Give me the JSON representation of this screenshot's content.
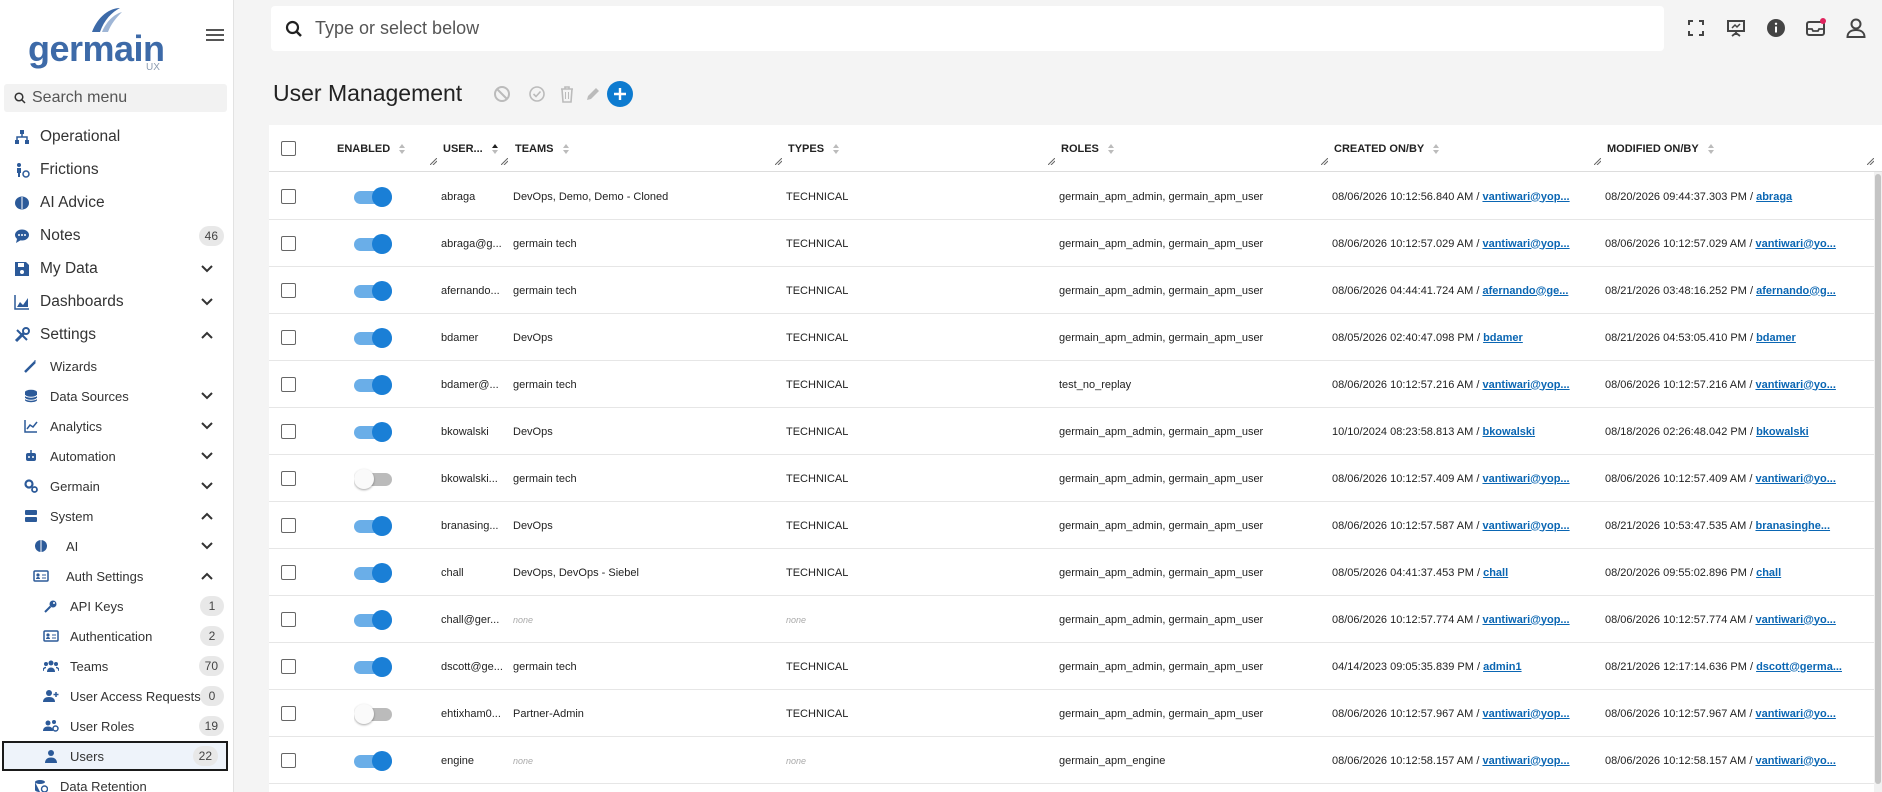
{
  "sidebar": {
    "logo_text": "germain",
    "logo_sub": "UX",
    "search_placeholder": "Search menu",
    "items": [
      {
        "label": "Operational"
      },
      {
        "label": "Frictions"
      },
      {
        "label": "AI Advice"
      },
      {
        "label": "Notes",
        "count": "46"
      },
      {
        "label": "My Data"
      },
      {
        "label": "Dashboards"
      },
      {
        "label": "Settings"
      },
      {
        "label": "Wizards"
      },
      {
        "label": "Data Sources"
      },
      {
        "label": "Analytics"
      },
      {
        "label": "Automation"
      },
      {
        "label": "Germain"
      },
      {
        "label": "System"
      },
      {
        "label": "AI"
      },
      {
        "label": "Auth Settings"
      },
      {
        "label": "API Keys",
        "count": "1"
      },
      {
        "label": "Authentication",
        "count": "2"
      },
      {
        "label": "Teams",
        "count": "70"
      },
      {
        "label": "User Access Requests",
        "count": "0"
      },
      {
        "label": "User Roles",
        "count": "19"
      },
      {
        "label": "Users",
        "count": "22"
      },
      {
        "label": "Data Retention"
      }
    ]
  },
  "topbar": {
    "search_placeholder": "Type or select below"
  },
  "page": {
    "title": "User Management"
  },
  "table": {
    "headers": {
      "enabled": "ENABLED",
      "user": "USER...",
      "teams": "TEAMS",
      "types": "TYPES",
      "roles": "ROLES",
      "created": "CREATED ON/BY",
      "modified": "MODIFIED ON/BY"
    },
    "rows": [
      {
        "enabled": true,
        "user": "abraga",
        "teams": "DevOps, Demo, Demo - Cloned",
        "types": "TECHNICAL",
        "roles": "germain_apm_admin, germain_apm_user",
        "created_on": "08/06/2026 10:12:56.840 AM /",
        "created_by": "vantiwari@yop...",
        "modified_on": "08/20/2026 09:44:37.303 PM /",
        "modified_by": "abraga"
      },
      {
        "enabled": true,
        "user": "abraga@g...",
        "teams": "germain tech",
        "types": "TECHNICAL",
        "roles": "germain_apm_admin, germain_apm_user",
        "created_on": "08/06/2026 10:12:57.029 AM /",
        "created_by": "vantiwari@yop...",
        "modified_on": "08/06/2026 10:12:57.029 AM /",
        "modified_by": "vantiwari@yo..."
      },
      {
        "enabled": true,
        "user": "afernando...",
        "teams": "germain tech",
        "types": "TECHNICAL",
        "roles": "germain_apm_admin, germain_apm_user",
        "created_on": "08/06/2026 04:44:41.724 AM /",
        "created_by": "afernando@ge...",
        "modified_on": "08/21/2026 03:48:16.252 PM /",
        "modified_by": "afernando@g..."
      },
      {
        "enabled": true,
        "user": "bdamer",
        "teams": "DevOps",
        "types": "TECHNICAL",
        "roles": "germain_apm_admin, germain_apm_user",
        "created_on": "08/05/2026 02:40:47.098 PM /",
        "created_by": "bdamer",
        "modified_on": "08/21/2026 04:53:05.410 PM /",
        "modified_by": "bdamer"
      },
      {
        "enabled": true,
        "user": "bdamer@...",
        "teams": "germain tech",
        "types": "TECHNICAL",
        "roles": "test_no_replay",
        "created_on": "08/06/2026 10:12:57.216 AM /",
        "created_by": "vantiwari@yop...",
        "modified_on": "08/06/2026 10:12:57.216 AM /",
        "modified_by": "vantiwari@yo..."
      },
      {
        "enabled": true,
        "user": "bkowalski",
        "teams": "DevOps",
        "types": "TECHNICAL",
        "roles": "germain_apm_admin, germain_apm_user",
        "created_on": "10/10/2024 08:23:58.813 AM /",
        "created_by": "bkowalski",
        "modified_on": "08/18/2026 02:26:48.042 PM /",
        "modified_by": "bkowalski"
      },
      {
        "enabled": false,
        "user": "bkowalski...",
        "teams": "germain tech",
        "types": "TECHNICAL",
        "roles": "germain_apm_admin, germain_apm_user",
        "created_on": "08/06/2026 10:12:57.409 AM /",
        "created_by": "vantiwari@yop...",
        "modified_on": "08/06/2026 10:12:57.409 AM /",
        "modified_by": "vantiwari@yo..."
      },
      {
        "enabled": true,
        "user": "branasing...",
        "teams": "DevOps",
        "types": "TECHNICAL",
        "roles": "germain_apm_admin, germain_apm_user",
        "created_on": "08/06/2026 10:12:57.587 AM /",
        "created_by": "vantiwari@yop...",
        "modified_on": "08/21/2026 10:53:47.535 AM /",
        "modified_by": "branasinghe..."
      },
      {
        "enabled": true,
        "user": "chall",
        "teams": "DevOps, DevOps - Siebel",
        "types": "TECHNICAL",
        "roles": "germain_apm_admin, germain_apm_user",
        "created_on": "08/05/2026 04:41:37.453 PM /",
        "created_by": "chall",
        "modified_on": "08/20/2026 09:55:02.896 PM /",
        "modified_by": "chall"
      },
      {
        "enabled": true,
        "user": "chall@ger...",
        "teams": "none",
        "types": "none",
        "roles": "germain_apm_admin, germain_apm_user",
        "created_on": "08/06/2026 10:12:57.774 AM /",
        "created_by": "vantiwari@yop...",
        "modified_on": "08/06/2026 10:12:57.774 AM /",
        "modified_by": "vantiwari@yo..."
      },
      {
        "enabled": true,
        "user": "dscott@ge...",
        "teams": "germain tech",
        "types": "TECHNICAL",
        "roles": "germain_apm_admin, germain_apm_user",
        "created_on": "04/14/2023 09:05:35.839 PM /",
        "created_by": "admin1",
        "modified_on": "08/21/2026 12:17:14.636 PM /",
        "modified_by": "dscott@germa..."
      },
      {
        "enabled": false,
        "user": "ehtixham0...",
        "teams": "Partner-Admin",
        "types": "TECHNICAL",
        "roles": "germain_apm_admin, germain_apm_user",
        "created_on": "08/06/2026 10:12:57.967 AM /",
        "created_by": "vantiwari@yop...",
        "modified_on": "08/06/2026 10:12:57.967 AM /",
        "modified_by": "vantiwari@yo..."
      },
      {
        "enabled": true,
        "user": "engine",
        "teams": "none",
        "types": "none",
        "roles": "germain_apm_engine",
        "created_on": "08/06/2026 10:12:58.157 AM /",
        "created_by": "vantiwari@yop...",
        "modified_on": "08/06/2026 10:12:58.157 AM /",
        "modified_by": "vantiwari@yo..."
      }
    ]
  },
  "colors": {
    "accent": "#0d7bd0",
    "toggle_on": "#1a7fd6",
    "link": "#0a66b3",
    "nav_icon": "#2c5a99",
    "notification_dot": "#e0245e"
  }
}
